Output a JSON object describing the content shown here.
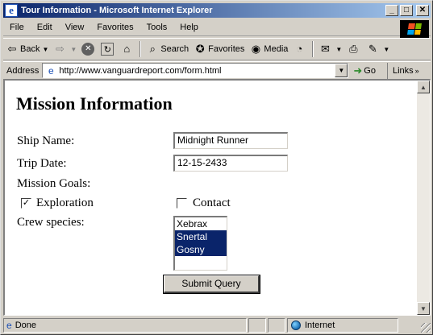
{
  "window": {
    "title": "Tour Information - Microsoft Internet Explorer",
    "controls": {
      "minimize": "_",
      "maximize": "□",
      "close": "✕"
    }
  },
  "menu": [
    "File",
    "Edit",
    "View",
    "Favorites",
    "Tools",
    "Help"
  ],
  "toolbar": {
    "back": "Back",
    "search": "Search",
    "favorites": "Favorites",
    "media": "Media"
  },
  "address": {
    "label": "Address",
    "url": "http://www.vanguardreport.com/form.html",
    "go": "Go",
    "links": "Links"
  },
  "form": {
    "heading": "Mission Information",
    "ship_name_label": "Ship Name:",
    "ship_name_value": "Midnight Runner",
    "trip_date_label": "Trip Date:",
    "trip_date_value": "12-15-2433",
    "mission_goals_label": "Mission Goals:",
    "goals": [
      {
        "label": "Exploration",
        "checked": true,
        "mark": "✓"
      },
      {
        "label": "Contact",
        "checked": false,
        "mark": ""
      }
    ],
    "crew_species_label": "Crew species:",
    "species": [
      {
        "label": "Xebrax",
        "selected": false
      },
      {
        "label": "Snertal",
        "selected": true
      },
      {
        "label": "Gosny",
        "selected": true
      }
    ],
    "submit_label": "Submit Query"
  },
  "status": {
    "text": "Done",
    "zone": "Internet"
  },
  "colors": {
    "titlebar_start": "#0a246a",
    "titlebar_end": "#a6caf0",
    "selection": "#0a246a",
    "chrome": "#d4d0c8"
  }
}
